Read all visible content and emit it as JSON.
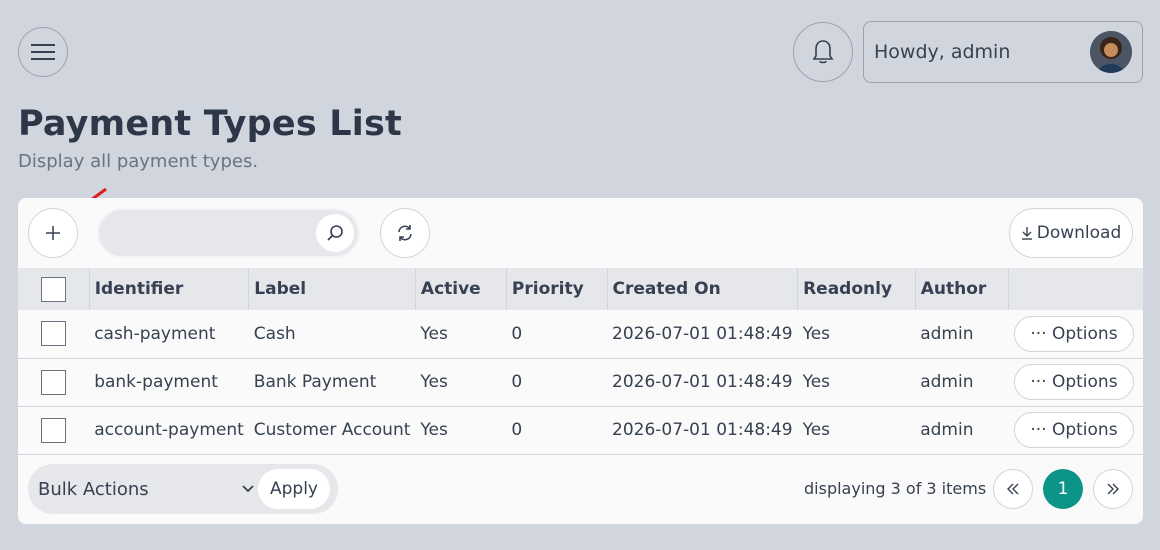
{
  "header": {
    "greeting": "Howdy, admin",
    "icons": {
      "menu": "hamburger-icon",
      "bell": "bell-icon",
      "avatar": "avatar"
    }
  },
  "page": {
    "title": "Payment Types List",
    "subtitle": "Display all payment types."
  },
  "toolbar": {
    "search_placeholder": "",
    "download_label": "Download",
    "icons": {
      "add": "plus-icon",
      "search": "search-icon",
      "refresh": "refresh-icon",
      "download": "download-icon"
    }
  },
  "table": {
    "columns": [
      "Identifier",
      "Label",
      "Active",
      "Priority",
      "Created On",
      "Readonly",
      "Author"
    ],
    "rows": [
      {
        "identifier": "cash-payment",
        "label": "Cash",
        "active": "Yes",
        "priority": "0",
        "created_on": "2026-07-01 01:48:49",
        "readonly": "Yes",
        "author": "admin",
        "options": "Options"
      },
      {
        "identifier": "bank-payment",
        "label": "Bank Payment",
        "active": "Yes",
        "priority": "0",
        "created_on": "2026-07-01 01:48:49",
        "readonly": "Yes",
        "author": "admin",
        "options": "Options"
      },
      {
        "identifier": "account-payment",
        "label": "Customer Account",
        "active": "Yes",
        "priority": "0",
        "created_on": "2026-07-01 01:48:49",
        "readonly": "Yes",
        "author": "admin",
        "options": "Options"
      }
    ]
  },
  "footer": {
    "bulk_actions": "Bulk Actions",
    "apply_label": "Apply",
    "display_info": "displaying 3 of 3 items",
    "current_page": "1"
  },
  "colors": {
    "accent": "#0d9488",
    "background": "#d1d5de",
    "annotation_arrow": "#e11d1d"
  }
}
